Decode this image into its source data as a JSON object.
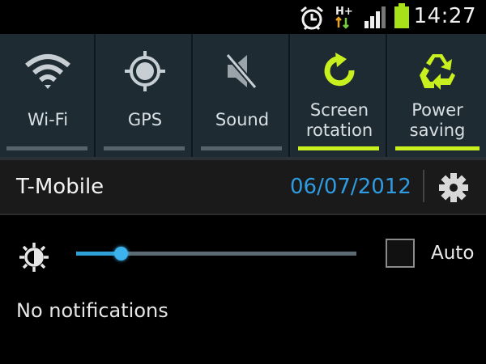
{
  "status_bar": {
    "clock": "14:27",
    "icons": [
      "alarm-icon",
      "h-plus-data-icon",
      "signal-icon",
      "battery-icon"
    ],
    "network_type": "H+",
    "battery_color": "#a6e11a"
  },
  "quick_settings": [
    {
      "label_line1": "Wi-Fi",
      "label_line2": "",
      "icon": "wifi-icon",
      "enabled": false
    },
    {
      "label_line1": "GPS",
      "label_line2": "",
      "icon": "gps-icon",
      "enabled": false
    },
    {
      "label_line1": "Sound",
      "label_line2": "",
      "icon": "sound-muted-icon",
      "enabled": false
    },
    {
      "label_line1": "Screen",
      "label_line2": "rotation",
      "icon": "rotation-icon",
      "enabled": true
    },
    {
      "label_line1": "Power",
      "label_line2": "saving",
      "icon": "recycle-icon",
      "enabled": true
    }
  ],
  "carrier_row": {
    "carrier": "T-Mobile",
    "date": "06/07/2012",
    "settings_icon": "gear-icon"
  },
  "brightness": {
    "icon": "brightness-icon",
    "level": 0.16,
    "auto_label": "Auto",
    "auto_checked": false
  },
  "notifications": {
    "empty_text": "No notifications"
  },
  "colors": {
    "accent_green": "#c8f01e",
    "accent_blue": "#2f9be0"
  }
}
